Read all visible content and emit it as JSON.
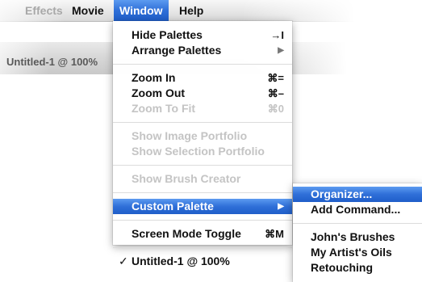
{
  "menubar": {
    "items": [
      {
        "label": "Effects"
      },
      {
        "label": "Movie"
      },
      {
        "label": "Window"
      },
      {
        "label": "Help"
      }
    ]
  },
  "document": {
    "tab_title": "Untitled-1 @ 100%"
  },
  "window_menu": {
    "hide_palettes": {
      "label": "Hide Palettes",
      "shortcut": "→I"
    },
    "arrange_palettes": {
      "label": "Arrange Palettes",
      "arrow": "▶"
    },
    "zoom_in": {
      "label": "Zoom In",
      "shortcut": "⌘="
    },
    "zoom_out": {
      "label": "Zoom Out",
      "shortcut": "⌘–"
    },
    "zoom_to_fit": {
      "label": "Zoom To Fit",
      "shortcut": "⌘0"
    },
    "show_image_portfolio": {
      "label": "Show Image Portfolio"
    },
    "show_selection_portfolio": {
      "label": "Show Selection Portfolio"
    },
    "show_brush_creator": {
      "label": "Show Brush Creator"
    },
    "custom_palette": {
      "label": "Custom Palette",
      "arrow": "▶"
    },
    "screen_mode_toggle": {
      "label": "Screen Mode Toggle",
      "shortcut": "⌘M"
    },
    "untitled_window": {
      "label": "Untitled-1 @ 100%",
      "check": "✓"
    }
  },
  "custom_palette_submenu": {
    "organizer": {
      "label": "Organizer..."
    },
    "add_command": {
      "label": "Add Command..."
    },
    "palettes": [
      {
        "label": "John's Brushes"
      },
      {
        "label": "My Artist's Oils"
      },
      {
        "label": "Retouching"
      }
    ]
  }
}
